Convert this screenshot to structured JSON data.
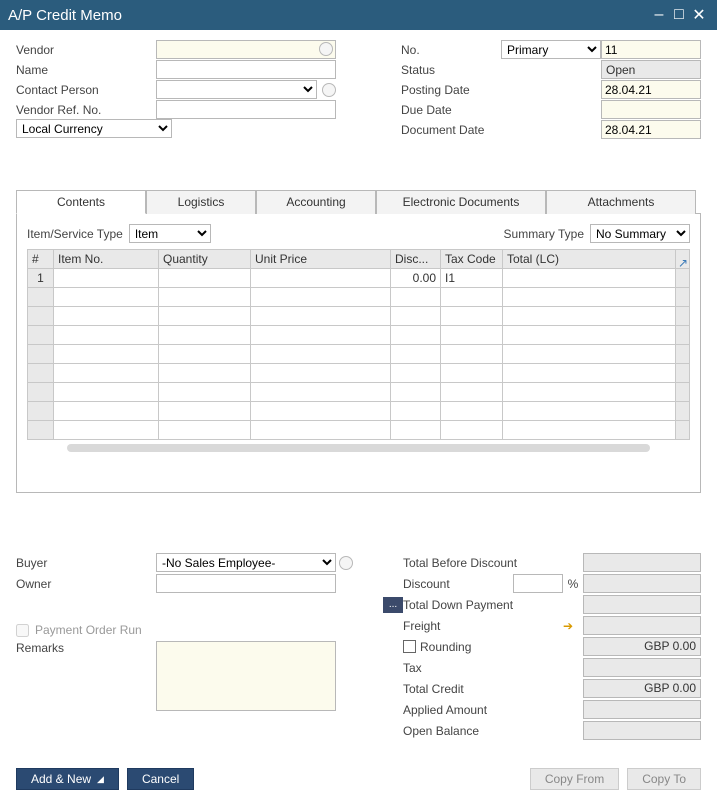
{
  "title": "A/P Credit Memo",
  "header_left": {
    "vendor_label": "Vendor",
    "vendor_value": "",
    "name_label": "Name",
    "name_value": "",
    "contact_label": "Contact Person",
    "contact_value": "",
    "vendorref_label": "Vendor Ref. No.",
    "vendorref_value": "",
    "currency_value": "Local Currency"
  },
  "header_right": {
    "no_label": "No.",
    "no_series": "Primary",
    "no_value": "11",
    "status_label": "Status",
    "status_value": "Open",
    "posting_label": "Posting Date",
    "posting_value": "28.04.21",
    "due_label": "Due Date",
    "due_value": "",
    "docdate_label": "Document Date",
    "docdate_value": "28.04.21"
  },
  "tabs": {
    "contents": "Contents",
    "logistics": "Logistics",
    "accounting": "Accounting",
    "edoc": "Electronic Documents",
    "attachments": "Attachments"
  },
  "contents_tab": {
    "item_service_label": "Item/Service Type",
    "item_service_value": "Item",
    "summary_label": "Summary Type",
    "summary_value": "No Summary",
    "columns": {
      "num": "#",
      "itemno": "Item No.",
      "qty": "Quantity",
      "unitprice": "Unit Price",
      "disc": "Disc...",
      "tax": "Tax Code",
      "total": "Total (LC)"
    },
    "row1": {
      "num": "1",
      "disc": "0.00",
      "tax": "I1"
    }
  },
  "bottom_left": {
    "buyer_label": "Buyer",
    "buyer_value": "-No Sales Employee-",
    "owner_label": "Owner",
    "owner_value": "",
    "payment_run_label": "Payment Order Run",
    "remarks_label": "Remarks",
    "remarks_value": ""
  },
  "totals": {
    "before_discount": "Total Before Discount",
    "discount": "Discount",
    "percent": "%",
    "down_payment": "Total Down Payment",
    "freight": "Freight",
    "rounding": "Rounding",
    "rounding_value": "GBP 0.00",
    "tax": "Tax",
    "total_credit": "Total Credit",
    "total_credit_value": "GBP 0.00",
    "applied": "Applied Amount",
    "open_balance": "Open Balance"
  },
  "footer": {
    "add_new": "Add & New",
    "cancel": "Cancel",
    "copy_from": "Copy From",
    "copy_to": "Copy To"
  }
}
